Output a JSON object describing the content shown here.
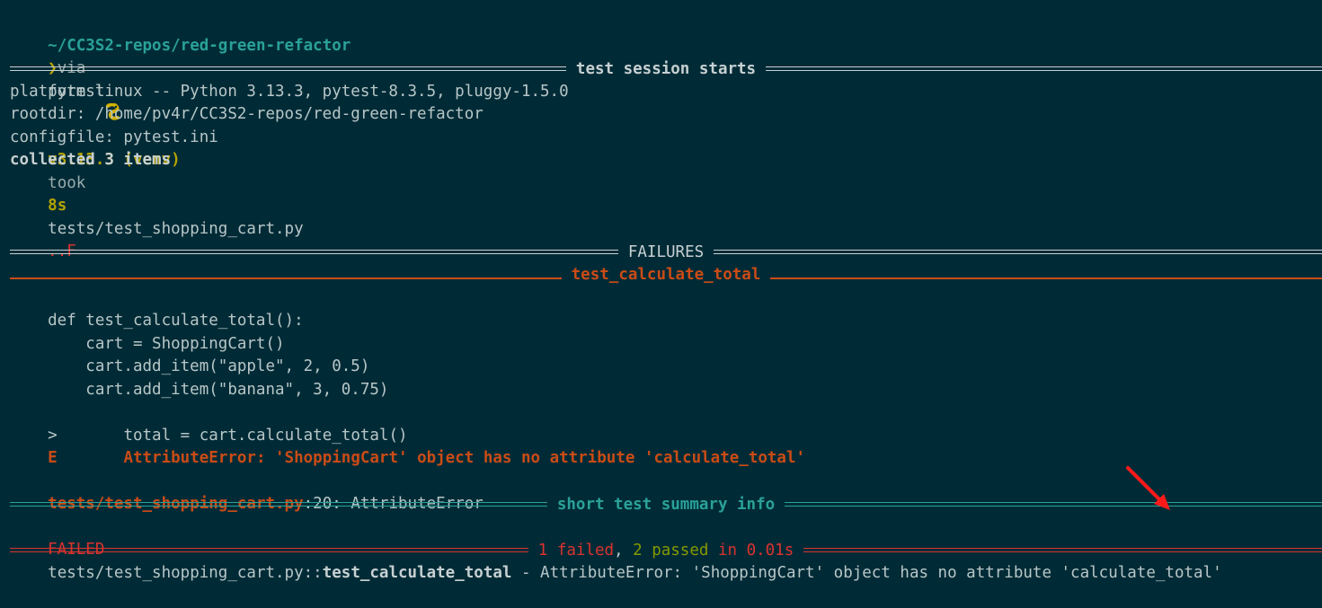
{
  "prompt": {
    "path": "~/CC3S2-repos/red-green-refactor",
    "via": "via",
    "python_icon": "python-snake-icon",
    "python_version": "v3.13.3 (venv)",
    "took_label": "took",
    "duration": "8s",
    "prompt_symbol": "❯",
    "command": "pytest"
  },
  "session": {
    "header": "test session starts",
    "platform": "platform linux -- Python 3.13.3, pytest-8.3.5, pluggy-1.5.0",
    "rootdir": "rootdir: /home/pv4r/CC3S2-repos/red-green-refactor",
    "configfile": "configfile: pytest.ini",
    "collected": "collected 3 items",
    "test_file": "tests/test_shopping_cart.py",
    "progress": "..F"
  },
  "failures": {
    "header": "FAILURES",
    "test_name": "test_calculate_total",
    "code_lines": [
      {
        "marker": "",
        "text": "    def test_calculate_total():"
      },
      {
        "marker": "",
        "text": "        cart = ShoppingCart()"
      },
      {
        "marker": "",
        "text": "        cart.add_item(\"apple\", 2, 0.5)"
      },
      {
        "marker": "",
        "text": "        cart.add_item(\"banana\", 3, 0.75)"
      },
      {
        "marker": ">",
        "text": "       total = cart.calculate_total()"
      }
    ],
    "error_marker": "E",
    "error_text": "       AttributeError: 'ShoppingCart' object has no attribute 'calculate_total'",
    "location_file": "tests/test_shopping_cart.py",
    "location_rest": ":20: AttributeError"
  },
  "summary": {
    "header": "short test summary info",
    "failed_label": "FAILED",
    "failed_path": "tests/test_shopping_cart.py",
    "failed_sep": "::",
    "failed_test": "test_calculate_total",
    "failed_message": " - AttributeError: 'ShoppingCart' object has no attribute 'calculate_total'",
    "result_failed": "1 failed",
    "result_comma": ", ",
    "result_passed": "2 passed",
    "result_time": " in 0.01s"
  },
  "annotation": {
    "arrow_color": "#ff1a1a",
    "arrow_icon": "red-arrow-icon"
  }
}
